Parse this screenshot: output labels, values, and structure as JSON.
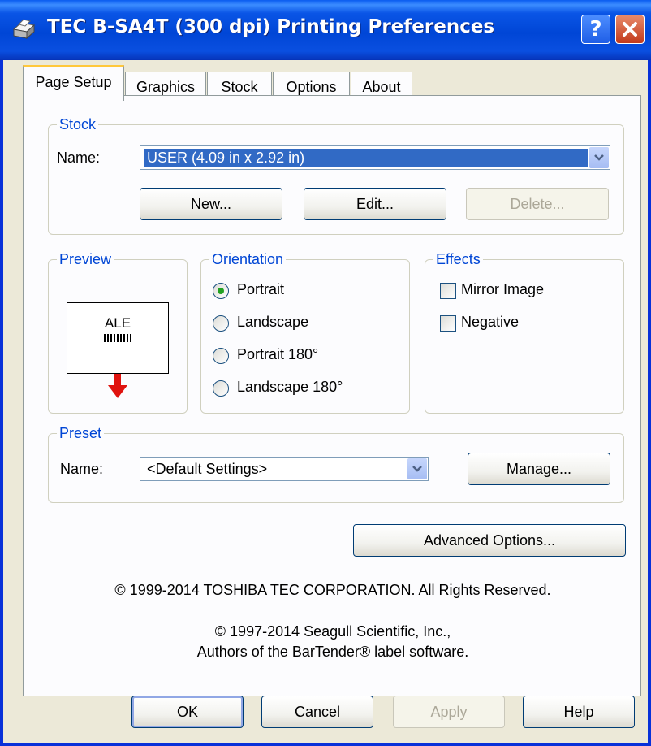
{
  "window": {
    "title": "TEC B-SA4T (300 dpi) Printing Preferences",
    "icon": "printer-icon",
    "help_glyph": "?"
  },
  "tabs": [
    {
      "label": "Page Setup",
      "active": true
    },
    {
      "label": "Graphics",
      "active": false
    },
    {
      "label": "Stock",
      "active": false
    },
    {
      "label": "Options",
      "active": false
    },
    {
      "label": "About",
      "active": false
    }
  ],
  "stock": {
    "group_label": "Stock",
    "name_label": "Name:",
    "name_value": "USER (4.09 in x 2.92 in)",
    "new_label": "New...",
    "edit_label": "Edit...",
    "delete_label": "Delete..."
  },
  "preview": {
    "group_label": "Preview",
    "text": "ALE"
  },
  "orientation": {
    "group_label": "Orientation",
    "selected": "Portrait",
    "options": [
      "Portrait",
      "Landscape",
      "Portrait 180°",
      "Landscape 180°"
    ]
  },
  "effects": {
    "group_label": "Effects",
    "mirror_image": {
      "label": "Mirror Image",
      "checked": false
    },
    "negative": {
      "label": "Negative",
      "checked": false
    }
  },
  "preset": {
    "group_label": "Preset",
    "name_label": "Name:",
    "name_value": "<Default Settings>",
    "manage_label": "Manage..."
  },
  "advanced_label": "Advanced Options...",
  "copyright": {
    "toshiba": "© 1999-2014 TOSHIBA TEC CORPORATION.  All Rights Reserved.",
    "seagull_1": "© 1997-2014 Seagull Scientific, Inc.,",
    "seagull_2": "Authors of the BarTender® label software."
  },
  "footer": {
    "ok": "OK",
    "cancel": "Cancel",
    "apply": "Apply",
    "help": "Help"
  },
  "colors": {
    "titlebar": "#0a4fe0",
    "group_label": "#0046d5",
    "selection": "#316ac5",
    "arrow": "#e0130f",
    "radio_dot": "#21a121"
  }
}
